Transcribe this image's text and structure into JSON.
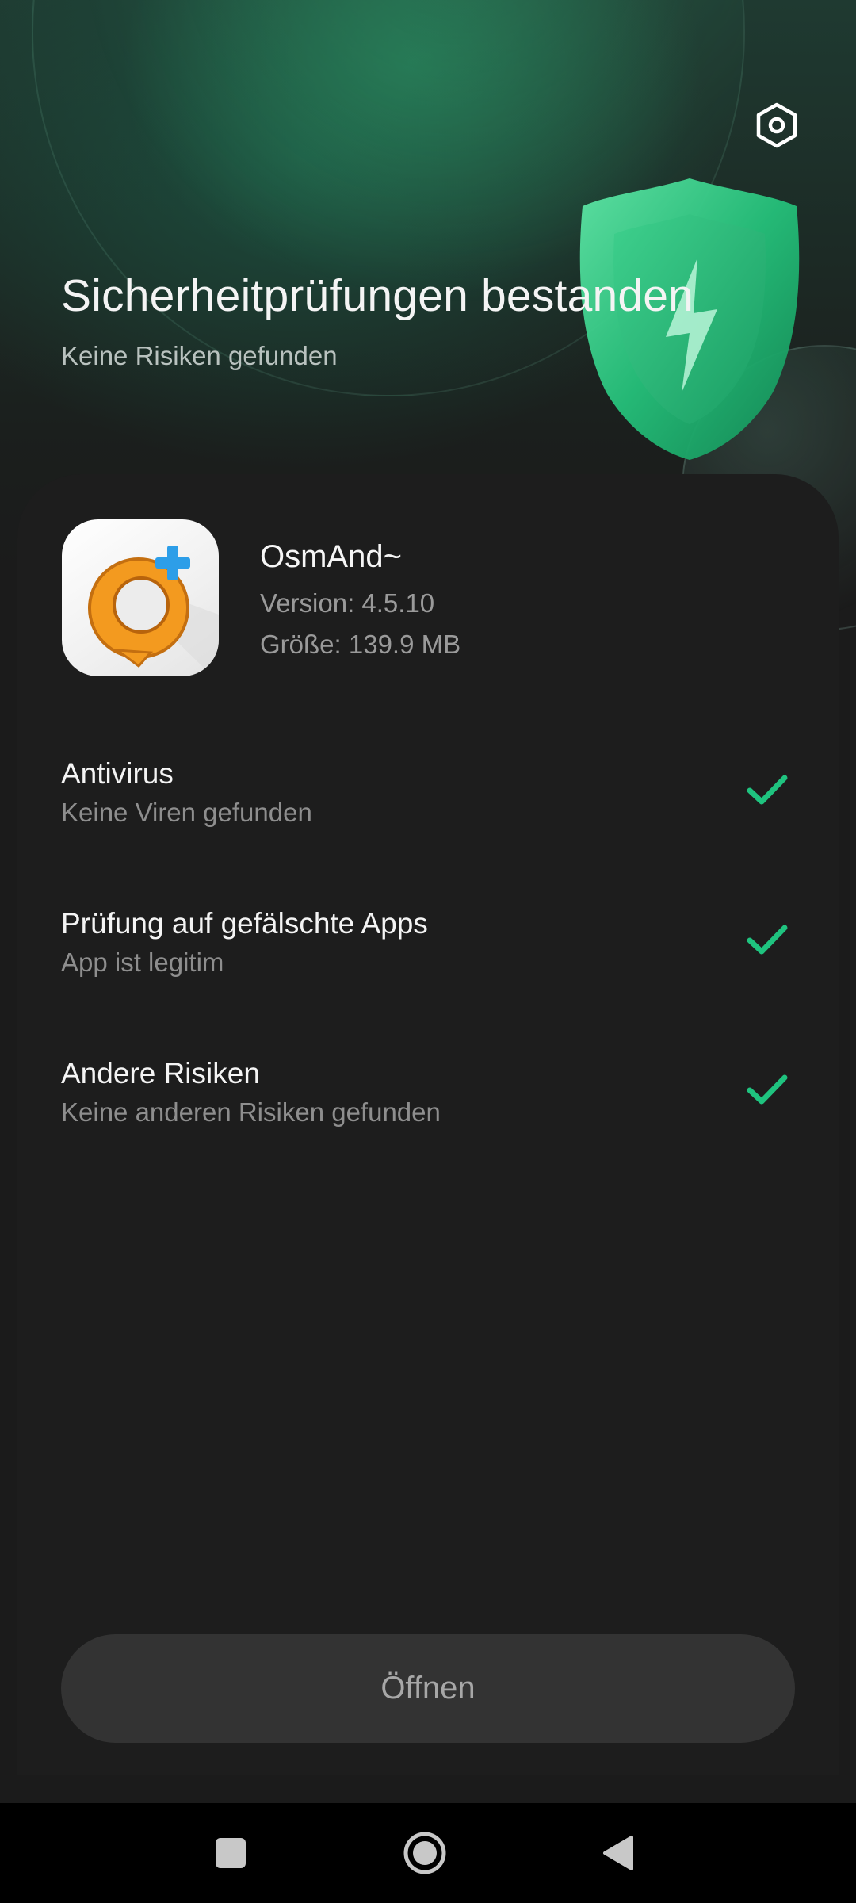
{
  "header": {
    "title": "Sicherheitprüfungen bestanden",
    "subtitle": "Keine Risiken gefunden",
    "settings_icon": "settings-hexagon-icon"
  },
  "app": {
    "name": "OsmAnd~",
    "version": "Version: 4.5.10",
    "size": "Größe: 139.9 MB",
    "icon": "osmand-app-icon"
  },
  "checks": [
    {
      "title": "Antivirus",
      "subtitle": "Keine Viren gefunden",
      "status_icon": "checkmark-icon"
    },
    {
      "title": "Prüfung auf gefälschte Apps",
      "subtitle": "App ist legitim",
      "status_icon": "checkmark-icon"
    },
    {
      "title": "Andere Risiken",
      "subtitle": "Keine anderen Risiken gefunden",
      "status_icon": "checkmark-icon"
    }
  ],
  "actions": {
    "open_label": "Öffnen"
  },
  "navbar": {
    "recents_icon": "square-recents-icon",
    "home_icon": "circle-home-icon",
    "back_icon": "triangle-back-icon"
  },
  "colors": {
    "accent_green": "#1fc37f",
    "background": "#1b1b1b",
    "button_bg": "#333333"
  }
}
